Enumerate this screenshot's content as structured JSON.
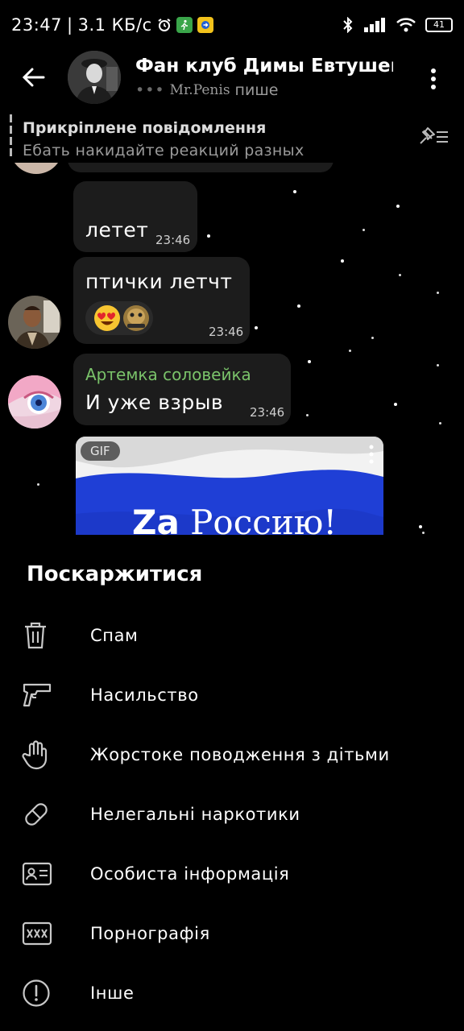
{
  "status_bar": {
    "time": "23:47",
    "separator": "|",
    "speed": "3.1 КБ/с",
    "battery": "41"
  },
  "header": {
    "title": "Фан клуб Димы Евтушен",
    "typing_user": "Mr.Penis",
    "typing_action": "пише"
  },
  "pinned": {
    "title": "Прикріплене повідомлення",
    "text": "Ебать накидайте реакций разных"
  },
  "messages": [
    {
      "text": "летет",
      "time": "23:46"
    },
    {
      "text": "птички летчт",
      "time": "23:46",
      "reactions": [
        "heart-eyes-emoji",
        "sticker-emoji"
      ]
    },
    {
      "sender": "Артемка соловейка",
      "text": "И уже взрыв",
      "time": "23:46"
    }
  ],
  "gif": {
    "badge": "GIF",
    "caption_a": "Za",
    "caption_b": " Россию!",
    "colors": {
      "white": "#f2f2f2",
      "blue": "#1f3fd6",
      "red": "#d52b1e"
    }
  },
  "report_sheet": {
    "title": "Поскаржитися",
    "options": [
      {
        "icon": "trash-icon",
        "label": "Спам"
      },
      {
        "icon": "gun-icon",
        "label": "Насильство"
      },
      {
        "icon": "hand-icon",
        "label": "Жорстоке поводження з дітьми"
      },
      {
        "icon": "pill-icon",
        "label": "Нелегальні наркотики"
      },
      {
        "icon": "id-card-icon",
        "label": "Особиста інформація"
      },
      {
        "icon": "xxx-icon",
        "label": "Порнографія"
      },
      {
        "icon": "alert-circle-icon",
        "label": "Інше"
      }
    ]
  },
  "colors": {
    "background": "#000000",
    "bubble": "#1c1c1c",
    "sender_name": "#7ac36a",
    "secondary_text": "#9a9a9a"
  }
}
